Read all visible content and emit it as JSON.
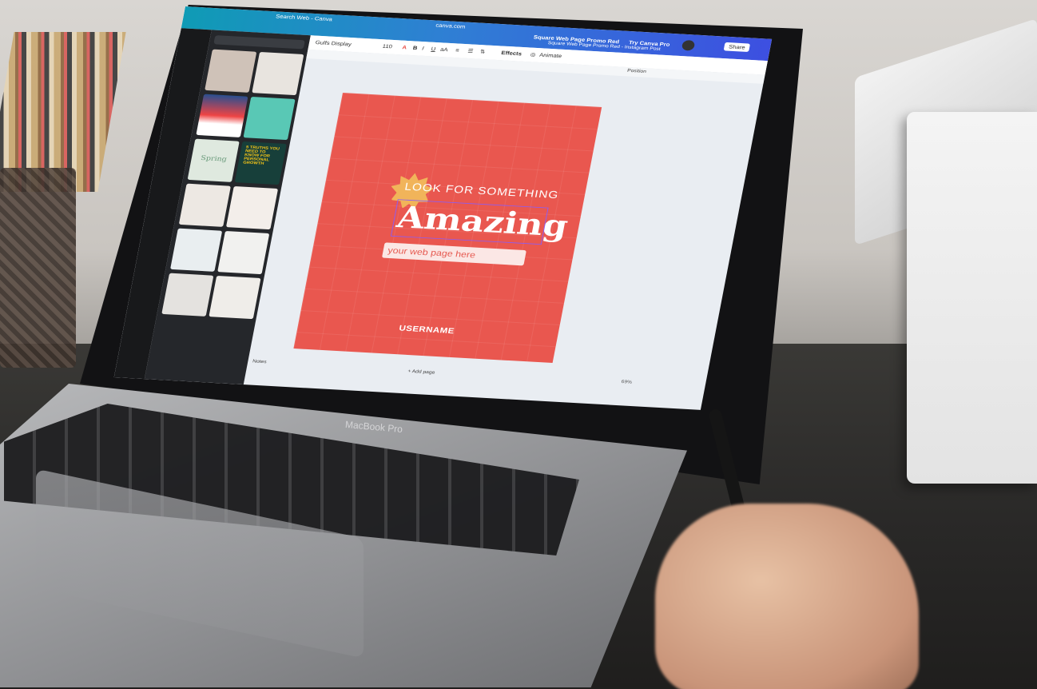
{
  "browser": {
    "tab_title": "Search Web - Canva",
    "url": "canva.com",
    "window_title": "Square Web Page Promo Red - Instagram Post"
  },
  "canva_header": {
    "design_name": "Square Web Page Promo Red",
    "try_pro_label": "Try Canva Pro",
    "share_label": "Share"
  },
  "toolbar": {
    "font_name": "Gulfs Display",
    "font_size": "110",
    "effects_label": "Effects",
    "animate_label": "Animate",
    "position_label": "Position"
  },
  "design": {
    "headline": "LOOK FOR SOMETHING",
    "big_word": "Amazing",
    "field_placeholder": "your web page here",
    "username": "USERNAME",
    "background_color": "#e9574f"
  },
  "panel": {
    "promo_text": "5 TRUTHS YOU NEED TO KNOW FOR PERSONAL GROWTH",
    "spring_label": "Spring"
  },
  "footer": {
    "notes_label": "Notes",
    "add_page_label": "+ Add page",
    "zoom": "69%"
  },
  "device": {
    "brand": "MacBook Pro"
  }
}
